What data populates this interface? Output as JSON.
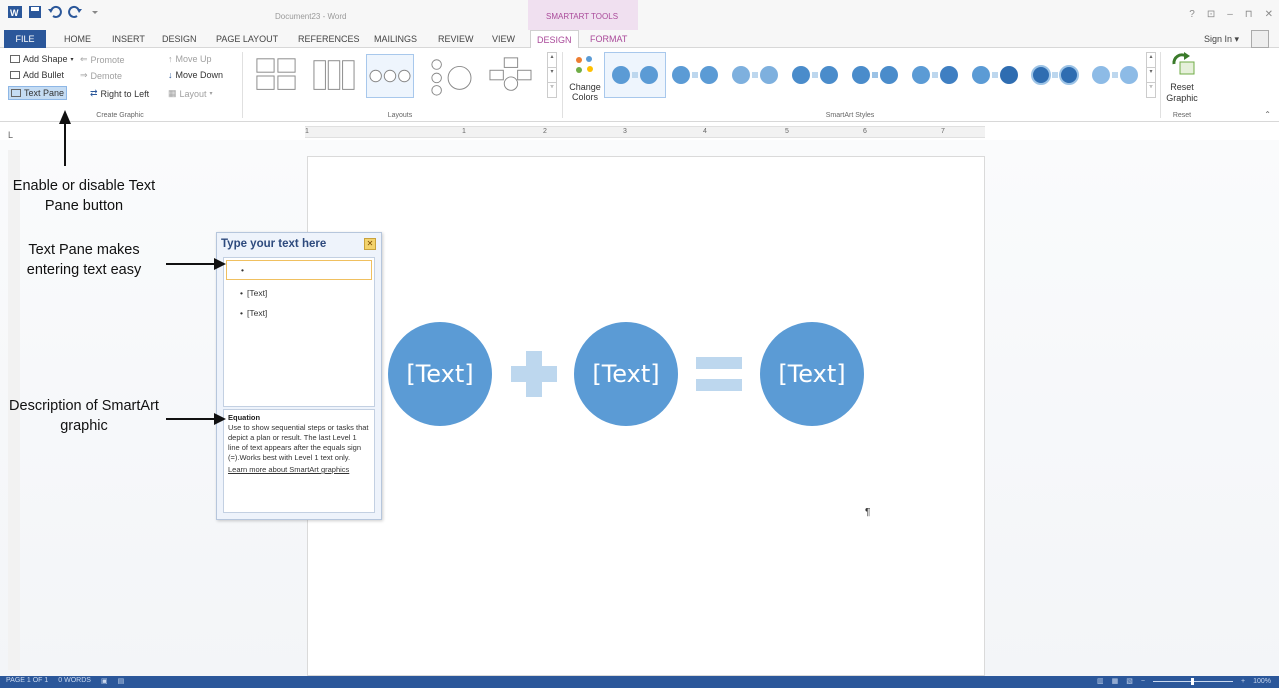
{
  "window": {
    "title": "Document23 - Word",
    "contextual_group": "SMARTART TOOLS",
    "controls": [
      "?",
      "⊡",
      "–",
      "⊓",
      "✕"
    ]
  },
  "tabs": [
    "FILE",
    "HOME",
    "INSERT",
    "DESIGN",
    "PAGE LAYOUT",
    "REFERENCES",
    "MAILINGS",
    "REVIEW",
    "VIEW",
    "DESIGN",
    "FORMAT"
  ],
  "active_tab": "DESIGN",
  "account": {
    "signin_label": "Sign In ▾"
  },
  "ribbon": {
    "create_graphic": {
      "label": "Create Graphic",
      "add_shape": "Add Shape",
      "add_bullet": "Add Bullet",
      "text_pane": "Text Pane",
      "promote": "Promote",
      "demote": "Demote",
      "right_to_left": "Right to Left",
      "move_up": "Move Up",
      "move_down": "Move Down",
      "layout": "Layout"
    },
    "layouts_label": "Layouts",
    "change_colors": "Change Colors",
    "smartart_styles_label": "SmartArt Styles",
    "reset_graphic": "Reset Graphic",
    "reset_label": "Reset"
  },
  "ruler": {
    "ticks": [
      "1",
      "1",
      "2",
      "3",
      "4",
      "5",
      "6",
      "7"
    ],
    "corner": "L"
  },
  "text_pane": {
    "title": "Type your text here",
    "close": "✕",
    "items": [
      "",
      "[Text]",
      "[Text]"
    ],
    "description_title": "Equation",
    "description_text": "Use to show sequential steps or tasks that depict a plan or result. The last Level 1 line of text appears after the equals sign (=).Works best with Level 1 text only.",
    "learn_more": "Learn more about SmartArt graphics"
  },
  "smartart": {
    "shapes": [
      "[Text]",
      "[Text]",
      "[Text]"
    ],
    "colors": {
      "circle": "#5b9bd5",
      "operator": "#bdd7ee"
    }
  },
  "pilcrow": "¶",
  "callouts": {
    "text_pane_button": "Enable or disable Text Pane button",
    "text_pane_easy": "Text Pane makes entering text easy",
    "description": "Description of SmartArt graphic"
  },
  "statusbar": {
    "page": "PAGE 1 OF 1",
    "words": "0 WORDS",
    "zoom": "100%"
  }
}
